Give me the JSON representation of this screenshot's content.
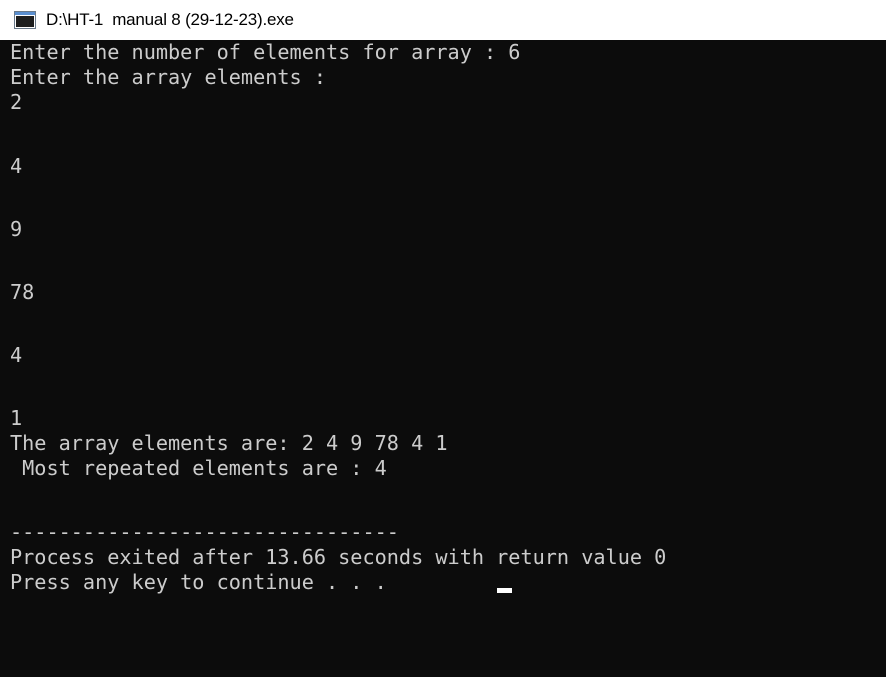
{
  "window": {
    "title": "D:\\HT-1  manual 8 (29-12-23).exe",
    "icon": "console-app-icon"
  },
  "console": {
    "lines": [
      "Enter the number of elements for array : 6",
      "Enter the array elements :",
      "2",
      "",
      "4",
      "",
      "9",
      "",
      "78",
      "",
      "4",
      "",
      "1",
      "The array elements are: 2 4 9 78 4 1",
      " Most repeated elements are : 4",
      "",
      "--------------------------------",
      "Process exited after 13.66 seconds with return value 0",
      "Press any key to continue . . . "
    ]
  },
  "colors": {
    "background": "#0c0c0c",
    "text": "#cccccc",
    "titlebar": "#ffffff"
  }
}
